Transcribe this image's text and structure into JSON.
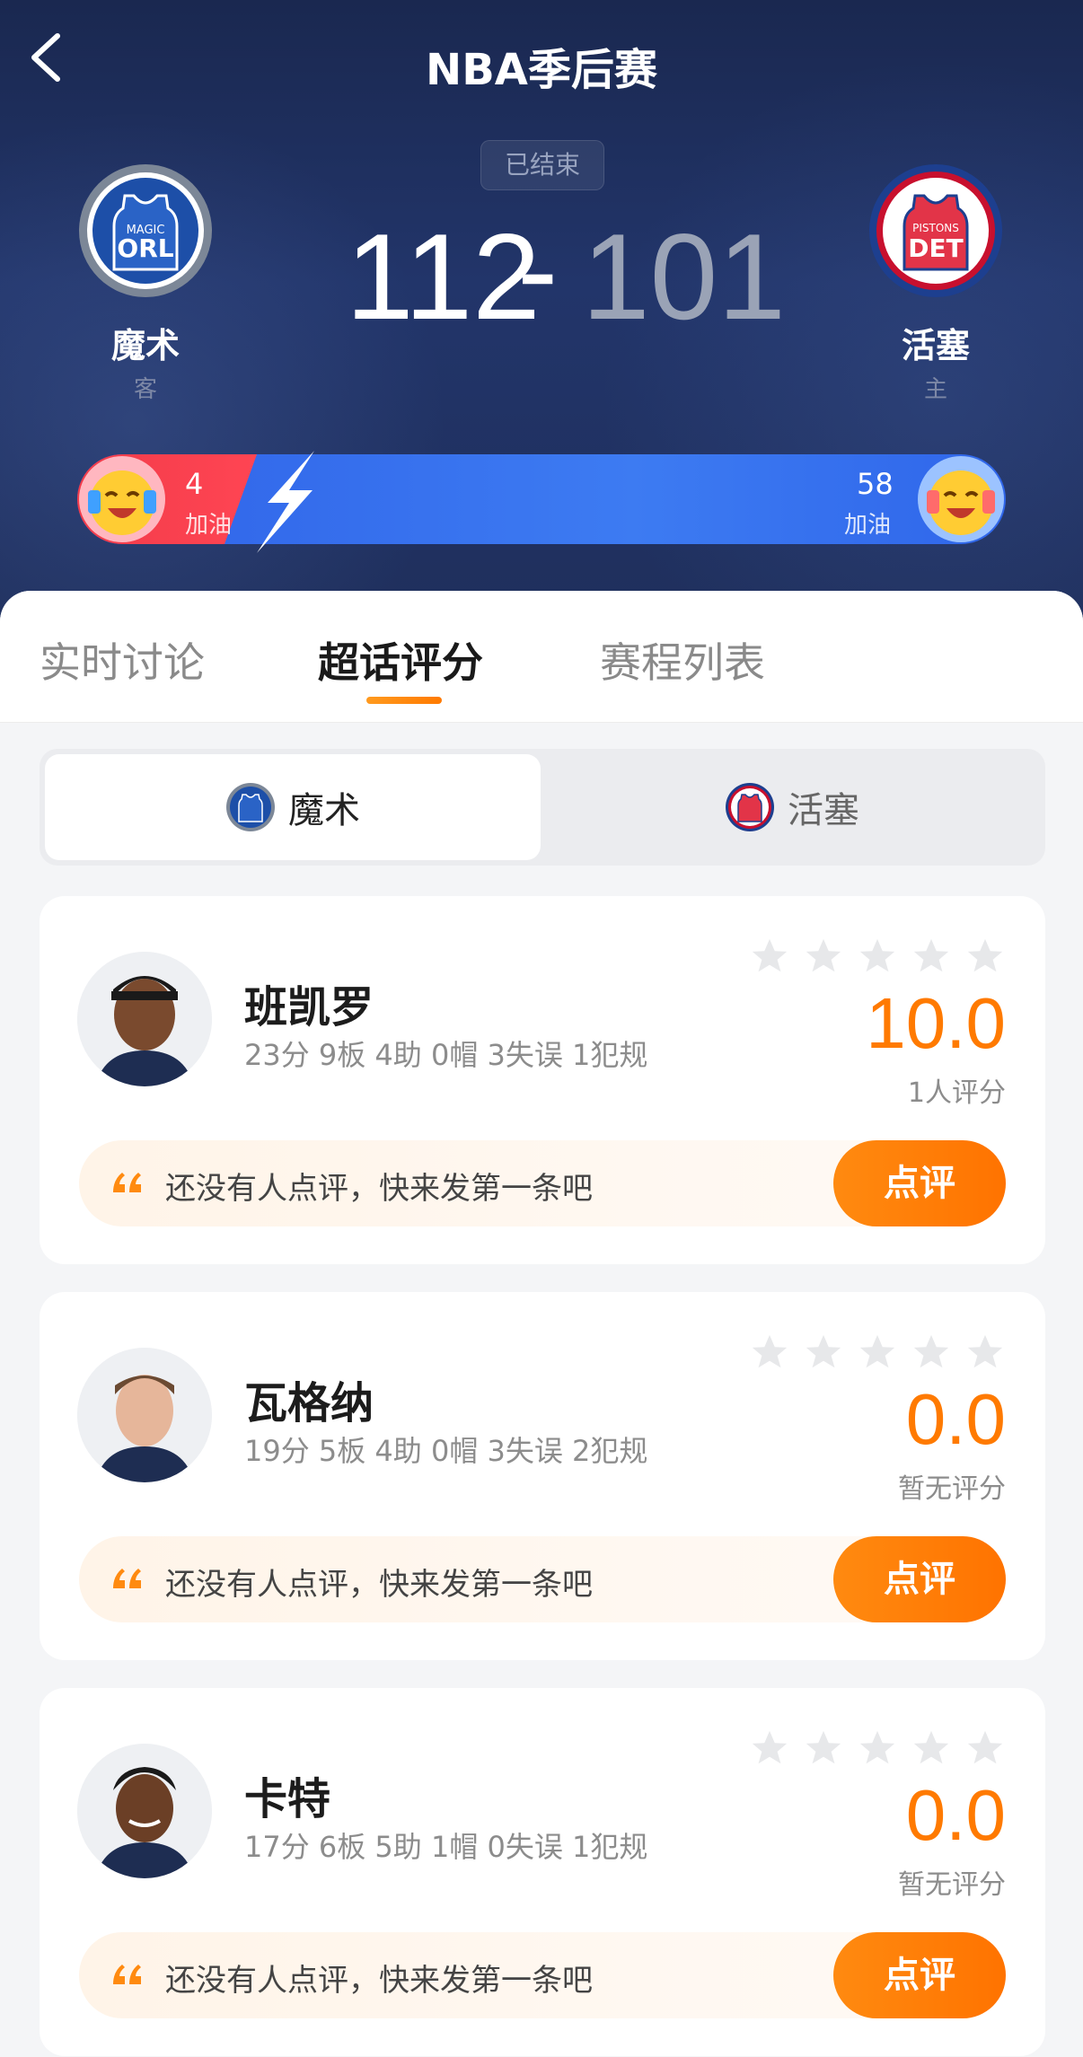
{
  "header": {
    "title": "NBA季后赛",
    "status": "已结束",
    "away": {
      "name": "魔术",
      "role": "客",
      "score": "112",
      "logo_text_top": "MAGIC",
      "logo_text": "ORL"
    },
    "home": {
      "name": "活塞",
      "role": "主",
      "score": "101",
      "logo_text_top": "PISTONS",
      "logo_text": "DET"
    },
    "score_separator": "-",
    "cheer": {
      "away_count": "4",
      "away_label": "加油",
      "home_count": "58",
      "home_label": "加油",
      "away_share": 0.065
    }
  },
  "tabs": [
    {
      "label": "实时讨论"
    },
    {
      "label": "超话评分"
    },
    {
      "label": "赛程列表"
    }
  ],
  "team_switch": {
    "left": "魔术",
    "right": "活塞"
  },
  "players": [
    {
      "name": "班凯罗",
      "stats": "23分 9板 4助 0帽 3失误 1犯规",
      "rating": "10.0",
      "rating_note": "1人评分",
      "comment_placeholder": "还没有人点评，快来发第一条吧",
      "button": "点评"
    },
    {
      "name": "瓦格纳",
      "stats": "19分 5板 4助 0帽 3失误 2犯规",
      "rating": "0.0",
      "rating_note": "暂无评分",
      "comment_placeholder": "还没有人点评，快来发第一条吧",
      "button": "点评"
    },
    {
      "name": "卡特",
      "stats": "17分 6板 5助 1帽 0失误 1犯规",
      "rating": "0.0",
      "rating_note": "暂无评分",
      "comment_placeholder": "还没有人点评，快来发第一条吧",
      "button": "点评"
    }
  ],
  "colors": {
    "accent": "#ff7a00",
    "away_team": "#1d4fa8",
    "home_team": "#c8102e",
    "header_bg": "#1f2f5c"
  }
}
